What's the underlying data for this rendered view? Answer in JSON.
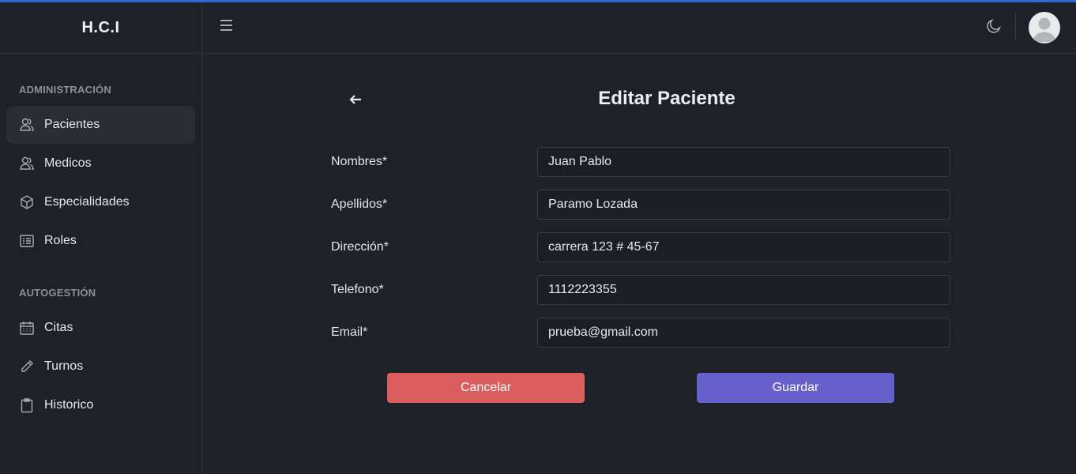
{
  "app": {
    "brand": "H.C.I"
  },
  "sidebar": {
    "sections": [
      {
        "title": "ADMINISTRACIÓN",
        "items": [
          {
            "label": "Pacientes",
            "icon": "users-icon",
            "active": true
          },
          {
            "label": "Medicos",
            "icon": "users-icon",
            "active": false
          },
          {
            "label": "Especialidades",
            "icon": "cube-icon",
            "active": false
          },
          {
            "label": "Roles",
            "icon": "list-icon",
            "active": false
          }
        ]
      },
      {
        "title": "AUTOGESTIÓN",
        "items": [
          {
            "label": "Citas",
            "icon": "calendar-icon",
            "active": false
          },
          {
            "label": "Turnos",
            "icon": "pencil-icon",
            "active": false
          },
          {
            "label": "Historico",
            "icon": "clipboard-icon",
            "active": false
          }
        ]
      }
    ]
  },
  "topbar": {
    "menu_icon": "hamburger-icon",
    "theme_icon": "moon-icon",
    "avatar_icon": "user-avatar-icon"
  },
  "form": {
    "title": "Editar Paciente",
    "back_icon": "arrow-left-icon",
    "fields": [
      {
        "label": "Nombres*",
        "value": "Juan Pablo"
      },
      {
        "label": "Apellidos*",
        "value": "Paramo Lozada"
      },
      {
        "label": "Dirección*",
        "value": "carrera 123 # 45-67"
      },
      {
        "label": "Telefono*",
        "value": "1112223355"
      },
      {
        "label": "Email*",
        "value": "prueba@gmail.com"
      }
    ],
    "cancel_label": "Cancelar",
    "save_label": "Guardar"
  },
  "colors": {
    "accent_top": "#2c6bd6",
    "cancel": "#dc5d5d",
    "save": "#6560cc",
    "background": "#1f2128"
  }
}
